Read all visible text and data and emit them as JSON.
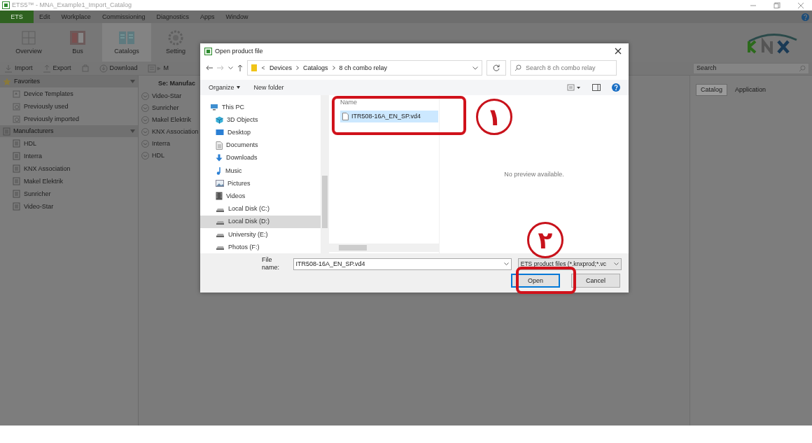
{
  "window": {
    "title": "ETS5™ - MNA_Example1_Import_Catalog"
  },
  "menu": [
    {
      "label": "ETS",
      "selected": true
    },
    {
      "label": "Edit",
      "selected": false
    },
    {
      "label": "Workplace",
      "selected": false
    },
    {
      "label": "Commissioning",
      "selected": false
    },
    {
      "label": "Diagnostics",
      "selected": false
    },
    {
      "label": "Apps",
      "selected": false
    },
    {
      "label": "Window",
      "selected": false
    }
  ],
  "ribbon": [
    {
      "label": "Overview",
      "kind": "overview",
      "selected": false
    },
    {
      "label": "Bus",
      "kind": "bus",
      "selected": false
    },
    {
      "label": "Catalogs",
      "kind": "catalogs",
      "selected": true
    },
    {
      "label": "Setting",
      "kind": "settings",
      "selected": false
    }
  ],
  "toolbar": [
    {
      "kind": "import",
      "label": "Import"
    },
    {
      "kind": "export",
      "label": "Export"
    },
    {
      "kind": "device"
    },
    {
      "kind": "download",
      "label": "Download"
    },
    {
      "kind": "view",
      "label": "M"
    }
  ],
  "search": {
    "placeholder": "Search"
  },
  "sidebar": [
    {
      "label": "Favorites",
      "kind": "star",
      "children": [
        {
          "label": "Device Templates",
          "kind": "template"
        },
        {
          "label": "Previously used",
          "kind": "history"
        },
        {
          "label": "Previously imported",
          "kind": "history"
        }
      ]
    },
    {
      "label": "Manufacturers",
      "kind": "building",
      "children": [
        {
          "label": "HDL",
          "kind": "building"
        },
        {
          "label": "Interra",
          "kind": "building"
        },
        {
          "label": "KNX Association",
          "kind": "building"
        },
        {
          "label": "Makel Elektrik",
          "kind": "building"
        },
        {
          "label": "Sunricher",
          "kind": "building"
        },
        {
          "label": "Video-Star",
          "kind": "building"
        }
      ]
    }
  ],
  "manufacturer_list": {
    "header": "Se: Manufac",
    "items": [
      "Video-Star",
      "Sunricher",
      "Makel Elektrik",
      "KNX Association",
      "Interra",
      "HDL"
    ]
  },
  "right_panel": {
    "tabs": [
      {
        "label": "Catalog",
        "selected": true
      },
      {
        "label": "Application",
        "selected": false
      }
    ]
  },
  "dialog": {
    "title": "Open product file",
    "breadcrumb": [
      "Devices",
      "Catalogs",
      "8 ch combo relay"
    ],
    "search_placeholder": "Search 8 ch combo relay",
    "commands": [
      {
        "label": "Organize",
        "kind": "menu"
      },
      {
        "label": "New folder",
        "kind": "plain"
      }
    ],
    "nav": [
      {
        "label": "This PC",
        "kind": "pc",
        "selected": false
      },
      {
        "label": "3D Objects",
        "kind": "cube",
        "selected": false
      },
      {
        "label": "Desktop",
        "kind": "desktop",
        "selected": false
      },
      {
        "label": "Documents",
        "kind": "documents",
        "selected": false
      },
      {
        "label": "Downloads",
        "kind": "downloads",
        "selected": false
      },
      {
        "label": "Music",
        "kind": "music",
        "selected": false
      },
      {
        "label": "Pictures",
        "kind": "pictures",
        "selected": false
      },
      {
        "label": "Videos",
        "kind": "videos",
        "selected": false
      },
      {
        "label": "Local Disk (C:)",
        "kind": "disk",
        "selected": false
      },
      {
        "label": "Local Disk (D:)",
        "kind": "disk",
        "selected": true
      },
      {
        "label": "University (E:)",
        "kind": "disk",
        "selected": false
      },
      {
        "label": "Photos (F:)",
        "kind": "disk",
        "selected": false
      }
    ],
    "column_header": "Name",
    "files": [
      {
        "name": "ITR508-16A_EN_SP.vd4",
        "selected": true
      }
    ],
    "preview": "No preview available.",
    "file_name_label": "File name:",
    "file_name_value": "ITR508-16A_EN_SP.vd4",
    "file_type": "ETS product files (*.knxprod;*.vc",
    "buttons": [
      {
        "label": "Open",
        "default": true
      },
      {
        "label": "Cancel",
        "default": false
      }
    ]
  },
  "annotations": [
    {
      "label": "۱"
    },
    {
      "label": "۲"
    }
  ]
}
